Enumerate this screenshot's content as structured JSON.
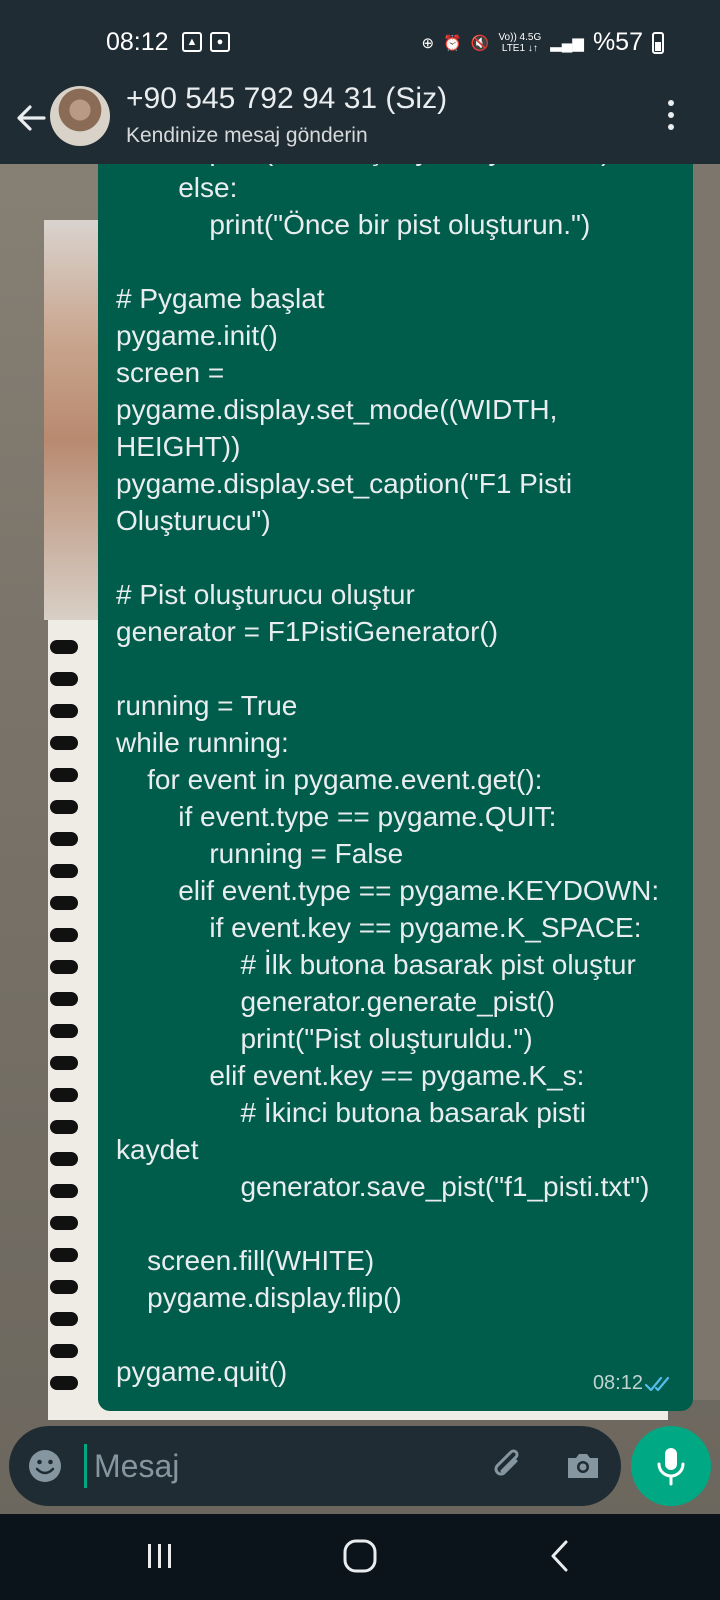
{
  "status_bar": {
    "time": "08:12",
    "network_top": "Vo)) 4.5G",
    "network_bottom": "LTE1 ↓↑",
    "battery": "%57"
  },
  "header": {
    "title": "+90 545 792 94 31 (Siz)",
    "subtitle": "Kendinize mesaj gönderin"
  },
  "message": {
    "code": "            print(\"Pist başarıyla kaydedildi.\")\n        else:\n            print(\"Önce bir pist oluşturun.\")\n\n# Pygame başlat\npygame.init()\nscreen =\npygame.display.set_mode((WIDTH,\nHEIGHT))\npygame.display.set_caption(\"F1 Pisti\nOluşturucu\")\n\n# Pist oluşturucu oluştur\ngenerator = F1PistiGenerator()\n\nrunning = True\nwhile running:\n    for event in pygame.event.get():\n        if event.type == pygame.QUIT:\n            running = False\n        elif event.type == pygame.KEYDOWN:\n            if event.key == pygame.K_SPACE:\n                # İlk butona basarak pist oluştur\n                generator.generate_pist()\n                print(\"Pist oluşturuldu.\")\n            elif event.key == pygame.K_s:\n                # İkinci butona basarak pisti\nkaydet\n                generator.save_pist(\"f1_pisti.txt\")\n\n    screen.fill(WHITE)\n    pygame.display.flip()\n\npygame.quit()",
    "time": "08:12"
  },
  "input": {
    "placeholder": "Mesaj"
  },
  "icons": {
    "back": "arrow-left-icon",
    "menu": "more-vert-icon",
    "emoji": "emoji-icon",
    "attach": "paperclip-icon",
    "camera": "camera-icon",
    "mic": "mic-icon",
    "read": "double-check-icon"
  },
  "colors": {
    "header_bg": "#202c33",
    "bubble_bg": "#005c4b",
    "accent": "#00a884",
    "read_ticks": "#53bdeb"
  }
}
